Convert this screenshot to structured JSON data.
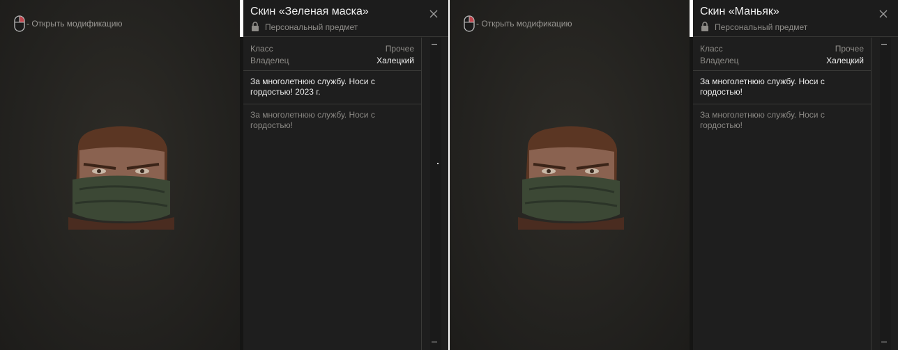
{
  "cards": [
    {
      "hint": "- Открыть модификацию",
      "title": "Скин «Зеленая маска»",
      "subtitle": "Персональный предмет",
      "stats": [
        {
          "label": "Класс",
          "value": "Прочее"
        },
        {
          "label": "Владелец",
          "value": "Халецкий"
        }
      ],
      "description": "За многолетнюю службу. Носи с гордостью! 2023 г.",
      "lore": "За многолетнюю службу. Носи с гордостью!"
    },
    {
      "hint": "- Открыть модификацию",
      "title": "Скин «Маньяк»",
      "subtitle": "Персональный предмет",
      "stats": [
        {
          "label": "Класс",
          "value": "Прочее"
        },
        {
          "label": "Владелец",
          "value": "Халецкий"
        }
      ],
      "description": "За многолетнюю службу. Носи с гордостью!",
      "lore": "За многолетнюю службу. Носи с гордостью!"
    }
  ],
  "icons": {
    "hint": "mouse-right-click-icon",
    "subtitle": "lock-icon",
    "close": "close-icon",
    "preview": "character-portrait"
  },
  "colors": {
    "accent": "#ffffff",
    "mouse_button": "#c0444c",
    "title": "#efefef",
    "muted": "#8e8c88"
  }
}
